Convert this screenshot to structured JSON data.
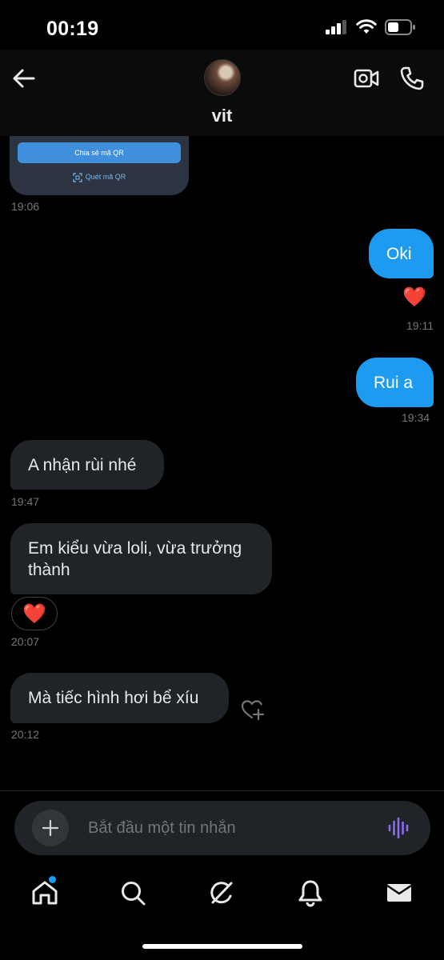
{
  "status_bar": {
    "time": "00:19"
  },
  "header": {
    "contact_name": "vit"
  },
  "qr_card": {
    "share_label": "Chia sẻ mã QR",
    "scan_label": "Quét mã QR"
  },
  "messages": [
    {
      "id": "qr",
      "direction": "incoming",
      "text": "",
      "time": "19:06"
    },
    {
      "id": "m1",
      "direction": "outgoing",
      "text": "Oki",
      "reaction": "❤️",
      "time": "19:11"
    },
    {
      "id": "m2",
      "direction": "outgoing",
      "text": "Rui a",
      "time": "19:34"
    },
    {
      "id": "m3",
      "direction": "incoming",
      "text": "A nhận rùi nhé",
      "time": "19:47"
    },
    {
      "id": "m4",
      "direction": "incoming",
      "text_line1": "Em kiểu vừa loli, vừa trưởng",
      "text_line2": "thành",
      "reaction": "❤️",
      "time": "20:07"
    },
    {
      "id": "m5",
      "direction": "incoming",
      "text": "Mà tiếc hình hơi bể xíu",
      "time": "20:12"
    }
  ],
  "composer": {
    "placeholder": "Bắt đầu một tin nhắn"
  },
  "colors": {
    "accent": "#1d9bf0",
    "incoming_bubble": "#202327",
    "timestamp": "#71767b",
    "voice_icon": "#8b6cf0"
  },
  "icons": [
    "back-arrow-icon",
    "video-call-icon",
    "phone-icon",
    "plus-icon",
    "voice-wave-icon",
    "home-icon",
    "search-icon",
    "grok-icon",
    "bell-icon",
    "mail-icon",
    "heart-plus-icon",
    "qr-scan-icon"
  ],
  "bottom_nav": {
    "items": [
      "home",
      "search",
      "grok",
      "notifications",
      "messages"
    ],
    "active": "home",
    "home_has_notification": true
  }
}
